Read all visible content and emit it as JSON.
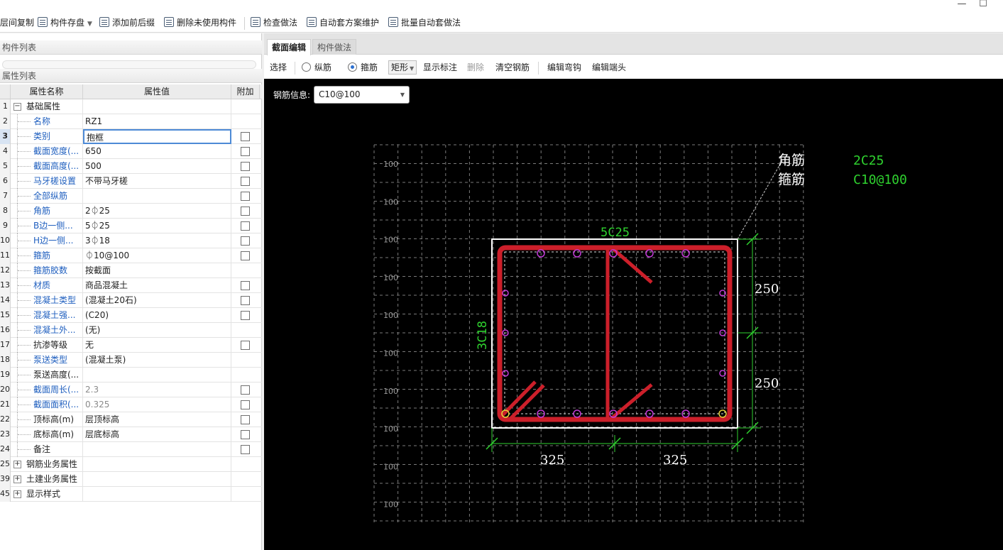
{
  "window": {
    "minimize": "—",
    "maximize": "☐"
  },
  "toolbar": {
    "floor_copy": "层间复制",
    "component_save": "构件存盘",
    "add_prefix": "添加前后缀",
    "delete_unused": "删除未使用构件",
    "check_method": "检查做法",
    "auto_scheme": "自动套方案维护",
    "batch_auto": "批量自动套做法"
  },
  "left": {
    "component_list_title": "构件列表",
    "property_list_title": "属性列表",
    "columns": {
      "name": "属性名称",
      "value": "属性值",
      "extra": "附加"
    },
    "rows": [
      {
        "num": "1",
        "name": "基础属性",
        "value": "",
        "expand": "−",
        "checkbox": false
      },
      {
        "num": "2",
        "name": "名称",
        "value": "RZ1",
        "blue": true,
        "checkbox": false
      },
      {
        "num": "3",
        "name": "类别",
        "value": "抱框",
        "blue": true,
        "checkbox": true,
        "selected": true
      },
      {
        "num": "4",
        "name": "截面宽度(...",
        "value": "650",
        "blue": true,
        "checkbox": true
      },
      {
        "num": "5",
        "name": "截面高度(...",
        "value": "500",
        "blue": true,
        "checkbox": true
      },
      {
        "num": "6",
        "name": "马牙槎设置",
        "value": "不带马牙槎",
        "blue": true,
        "checkbox": true
      },
      {
        "num": "7",
        "name": "全部纵筋",
        "value": "",
        "blue": true,
        "checkbox": true
      },
      {
        "num": "8",
        "name": "角筋",
        "value": "2⏀25",
        "blue": true,
        "checkbox": true
      },
      {
        "num": "9",
        "name": "B边一侧...",
        "value": "5⏀25",
        "blue": true,
        "checkbox": true
      },
      {
        "num": "10",
        "name": "H边一侧...",
        "value": "3⏀18",
        "blue": true,
        "checkbox": true
      },
      {
        "num": "11",
        "name": "箍筋",
        "value": "⏀10@100",
        "blue": true,
        "checkbox": true
      },
      {
        "num": "12",
        "name": "箍筋胶数",
        "value": "按截面",
        "blue": true,
        "checkbox": false
      },
      {
        "num": "13",
        "name": "材质",
        "value": "商品混凝土",
        "blue": true,
        "checkbox": true
      },
      {
        "num": "14",
        "name": "混凝土类型",
        "value": "(混凝土20石)",
        "blue": true,
        "checkbox": true
      },
      {
        "num": "15",
        "name": "混凝土强...",
        "value": "(C20)",
        "blue": true,
        "checkbox": true
      },
      {
        "num": "16",
        "name": "混凝土外...",
        "value": "(无)",
        "blue": true,
        "checkbox": false
      },
      {
        "num": "17",
        "name": "抗渗等级",
        "value": "无",
        "checkbox": true
      },
      {
        "num": "18",
        "name": "泵送类型",
        "value": "(混凝土泵)",
        "blue": true,
        "checkbox": false
      },
      {
        "num": "19",
        "name": "泵送高度(...",
        "value": "",
        "checkbox": false
      },
      {
        "num": "20",
        "name": "截面周长(...",
        "value": "2.3",
        "blue": true,
        "gray": true,
        "checkbox": true
      },
      {
        "num": "21",
        "name": "截面面积(...",
        "value": "0.325",
        "blue": true,
        "gray": true,
        "checkbox": true
      },
      {
        "num": "22",
        "name": "顶标高(m)",
        "value": "层顶标高",
        "checkbox": true
      },
      {
        "num": "23",
        "name": "底标高(m)",
        "value": "层底标高",
        "checkbox": true
      },
      {
        "num": "24",
        "name": "备注",
        "value": "",
        "checkbox": true
      },
      {
        "num": "25",
        "name": "钢筋业务属性",
        "value": "",
        "expand": "+",
        "checkbox": false
      },
      {
        "num": "39",
        "name": "土建业务属性",
        "value": "",
        "expand": "+",
        "checkbox": false
      },
      {
        "num": "45",
        "name": "显示样式",
        "value": "",
        "expand": "+",
        "checkbox": false
      }
    ]
  },
  "right": {
    "tabs": [
      "截面编辑",
      "构件做法"
    ],
    "edit_toolbar": {
      "select": "选择",
      "longitudinal": "纵筋",
      "stirrup": "箍筋",
      "shape": "矩形",
      "show_label": "显示标注",
      "delete": "删除",
      "clear_rebar": "清空钢筋",
      "edit_bend": "编辑弯钩",
      "edit_end": "编辑端头"
    },
    "rebar_info_label": "钢筋信息:",
    "rebar_info_value": "C10@100"
  },
  "drawing": {
    "grid_label": "100",
    "grid_labels_count": 10,
    "top_label": "5C25",
    "side_label": "3C18",
    "right_dims": [
      "250",
      "250"
    ],
    "bottom_dims": [
      "325",
      "325"
    ],
    "legend": [
      {
        "name": "角筋",
        "value": "2C25"
      },
      {
        "name": "箍筋",
        "value": "C10@100"
      }
    ],
    "colors": {
      "rebar": "#cc1f2a",
      "dim": "#2fd22f",
      "grid": "#7a7a7a",
      "bar_dot": "#c23ad6",
      "text": "#ffffff"
    }
  }
}
